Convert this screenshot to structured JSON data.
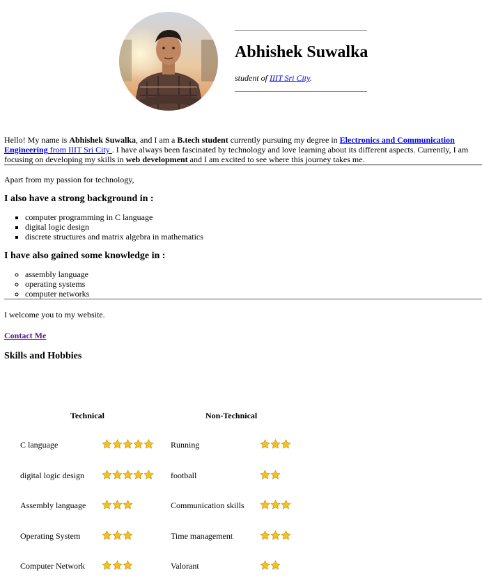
{
  "hero": {
    "name": "Abhishek Suwalka",
    "tagline_prefix": "student of ",
    "tagline_link": "IIIT Sri City",
    "tagline_suffix": "."
  },
  "intro": {
    "t1": "Hello! My name is ",
    "b1": "Abhishek Suwalka",
    "t2": ", and I am a ",
    "b2": "B.tech student",
    "t3": " currently pursuing my degree in ",
    "link_bold": "Electronics and Communication Engineering",
    "link_rest": " from IIIT Sri City ",
    "t4": ". I have always been fascinated by technology and love learning about its different aspects. Currently, I am focusing on developing my skills in ",
    "b3": "web development",
    "t5": " and I am excited to see where this journey takes me."
  },
  "passion": "Apart from my passion for technology,",
  "background": {
    "heading": "I also have a strong background in :",
    "items": [
      "computer programming in C language",
      "digital logic design",
      "discrete structures and matrix algebra in mathematics"
    ]
  },
  "knowledge": {
    "heading": "I have also gained some knowledge in :",
    "items": [
      "assembly language",
      "operating systems",
      "computer networks"
    ]
  },
  "welcome": "I welcome you to my website.",
  "contact_link": "Contact Me",
  "skills_heading": "Skills and Hobbies",
  "skills": {
    "technical_heading": "Technical",
    "nontechnical_heading": "Non-Technical",
    "technical": [
      {
        "name": "C language",
        "stars": 5
      },
      {
        "name": "digital logic design",
        "stars": 5
      },
      {
        "name": "Assembly language",
        "stars": 3
      },
      {
        "name": "Operating System",
        "stars": 3
      },
      {
        "name": "Computer Network",
        "stars": 3
      }
    ],
    "nontechnical": [
      {
        "name": "Running",
        "stars": 3
      },
      {
        "name": "football",
        "stars": 2
      },
      {
        "name": "Communication skills",
        "stars": 3
      },
      {
        "name": "Time management",
        "stars": 3
      },
      {
        "name": "Valorant",
        "stars": 2
      }
    ]
  },
  "colors": {
    "link": "#0000ee",
    "visited_link": "#551a8b",
    "star_fill": "#f5c21b",
    "rule": "#8c8c8c"
  }
}
